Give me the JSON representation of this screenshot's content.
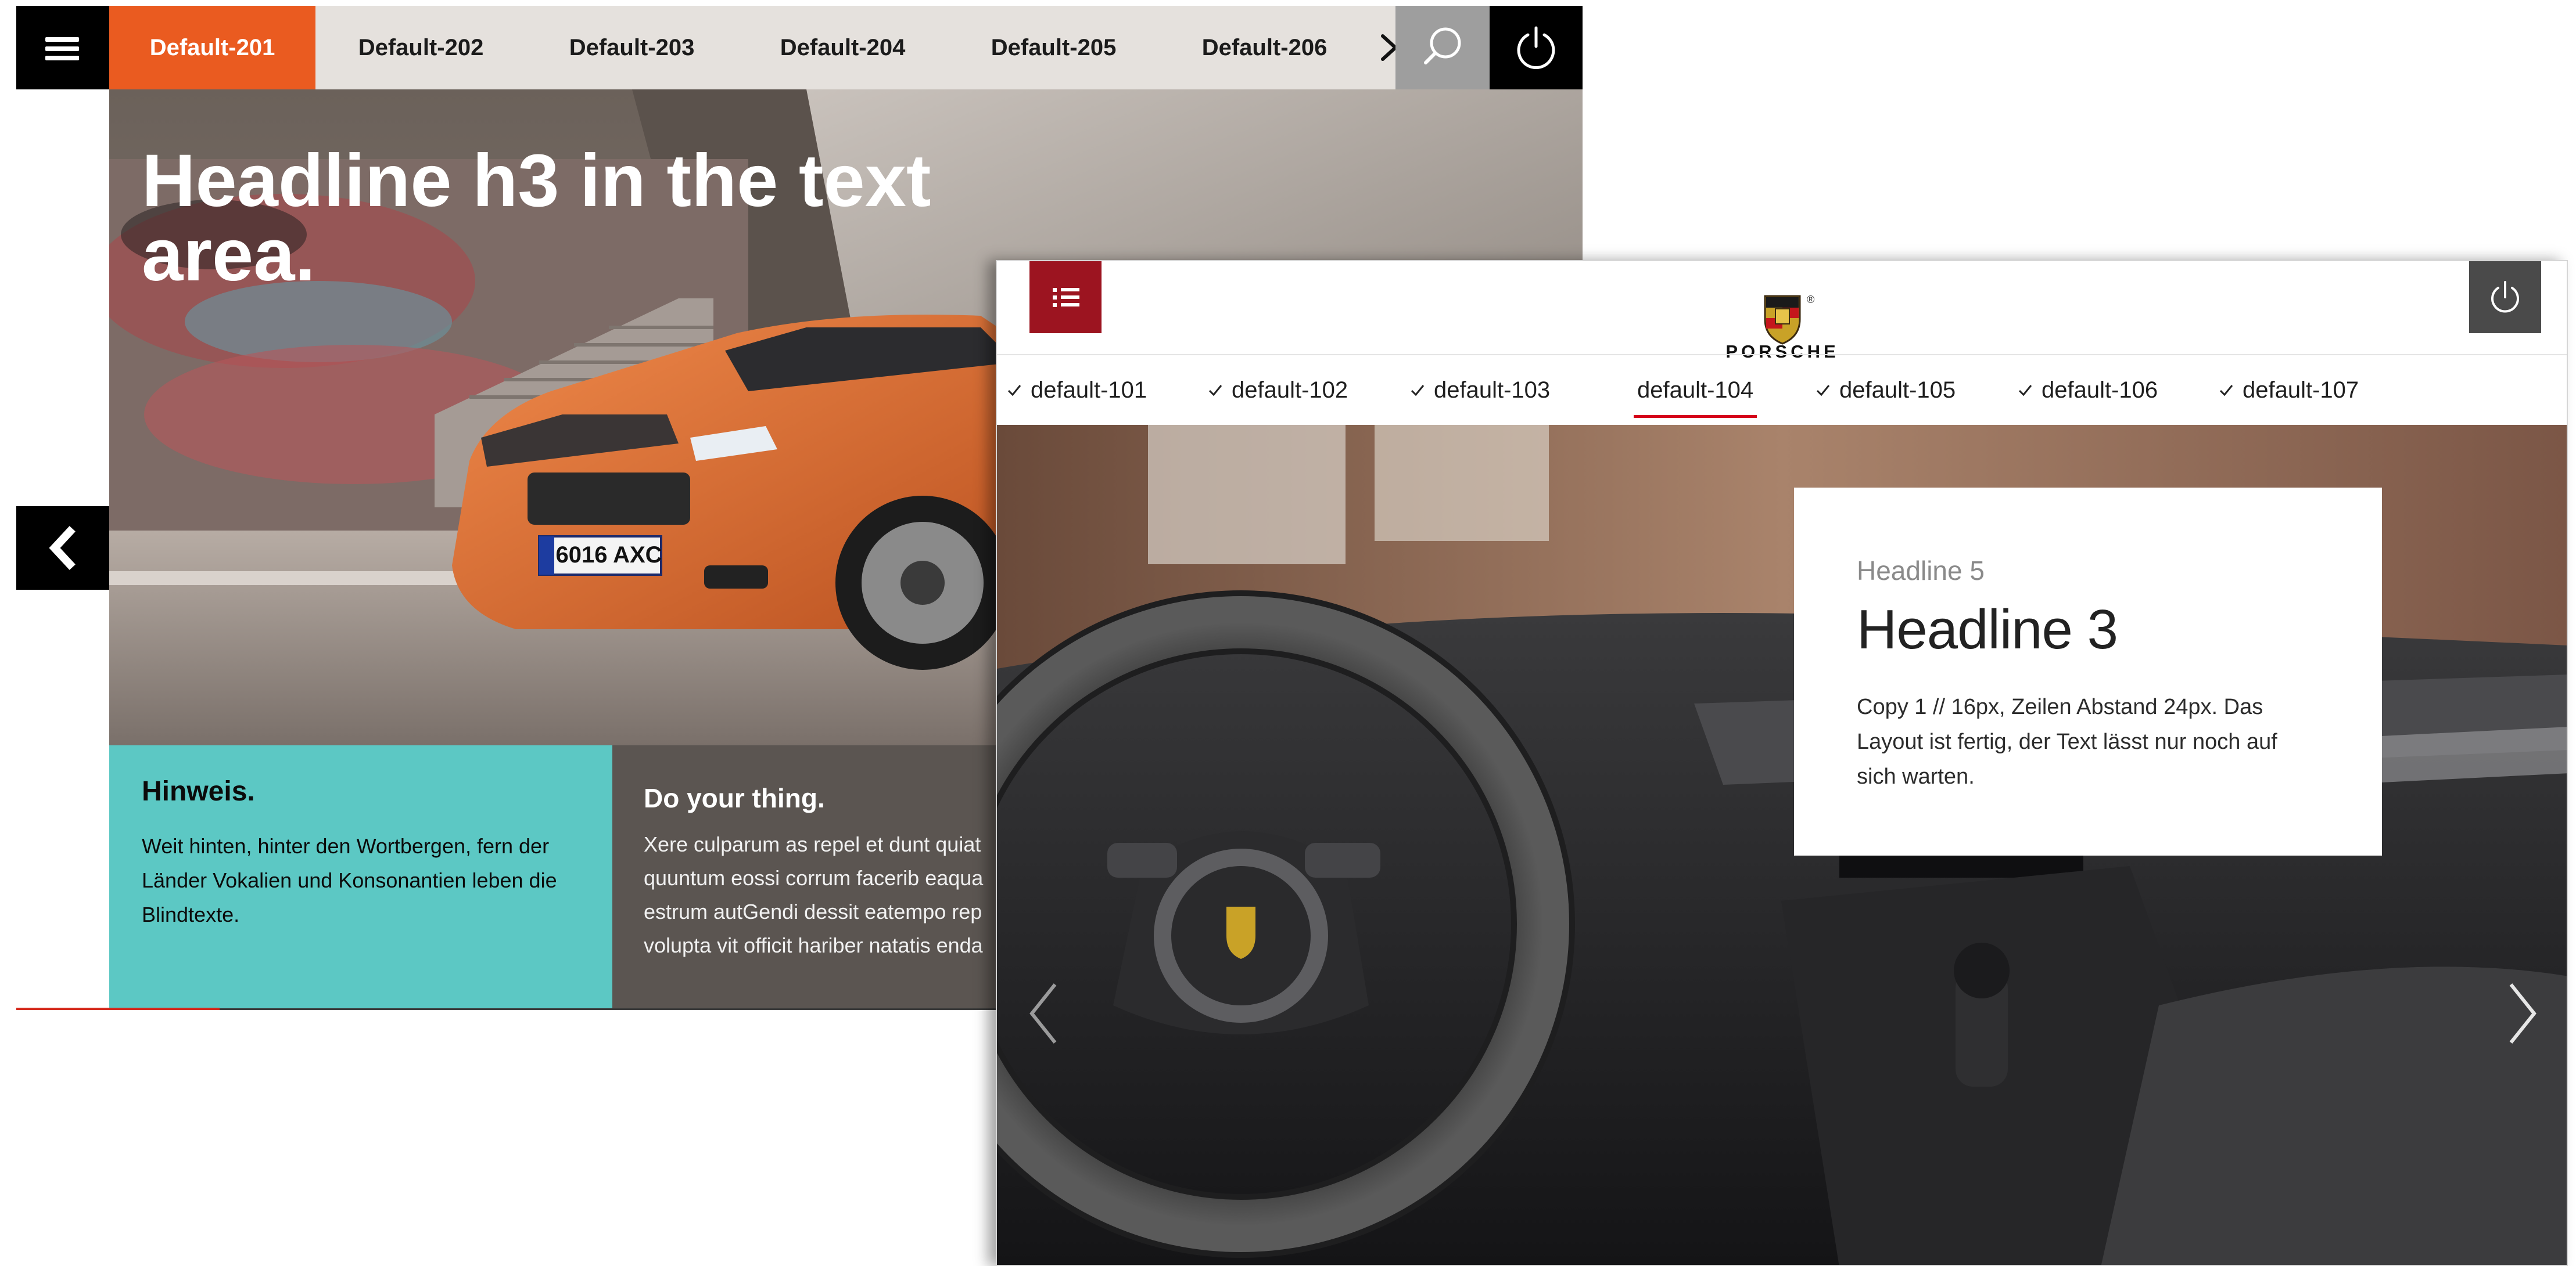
{
  "seat_window": {
    "tabs": [
      {
        "label": "Default-201",
        "active": true
      },
      {
        "label": "Default-202",
        "active": false
      },
      {
        "label": "Default-203",
        "active": false
      },
      {
        "label": "Default-204",
        "active": false
      },
      {
        "label": "Default-205",
        "active": false
      },
      {
        "label": "Default-206",
        "active": false
      }
    ],
    "headline": "Headline h3 in the text area.",
    "notice": {
      "title": "Hinweis.",
      "text": "Weit hinten, hinter den Wortbergen, fern der Länder Vokalien und Konsonantien leben die Blindtexte."
    },
    "promo": {
      "title": "Do your thing.",
      "lines": [
        "Xere culparum as repel et dunt quiat",
        "quuntum eossi corrum facerib eaqua",
        "estrum autGendi dessit eatempo rep",
        "volupta vit officit hariber natatis enda"
      ]
    },
    "license_plate": "6016 AXC",
    "colors": {
      "accent": "#ea5b20",
      "teal": "#5cc8c4",
      "bar": "#e5e1dd"
    },
    "icons": [
      "menu-icon",
      "chevron-right-icon",
      "search-icon",
      "power-icon",
      "chevron-left-icon"
    ]
  },
  "porsche_window": {
    "brand": "PORSCHE",
    "tabs": [
      {
        "label": "default-101",
        "checked": true,
        "active": false
      },
      {
        "label": "default-102",
        "checked": true,
        "active": false
      },
      {
        "label": "default-103",
        "checked": true,
        "active": false
      },
      {
        "label": "default-104",
        "checked": false,
        "active": true
      },
      {
        "label": "default-105",
        "checked": true,
        "active": false
      },
      {
        "label": "default-106",
        "checked": true,
        "active": false
      },
      {
        "label": "default-107",
        "checked": true,
        "active": false
      }
    ],
    "card": {
      "kicker": "Headline 5",
      "headline": "Headline 3",
      "copy": "Copy 1 // 16px, Zeilen Abstand 24px. Das Layout ist fertig, der Text lässt nur noch auf sich warten."
    },
    "colors": {
      "accent": "#d5001c",
      "menu_button": "#9c1420",
      "power_button": "#4a4a4a"
    },
    "icons": [
      "list-menu-icon",
      "porsche-crest-icon",
      "power-icon",
      "check-icon",
      "chevron-left-icon",
      "chevron-right-icon"
    ]
  }
}
